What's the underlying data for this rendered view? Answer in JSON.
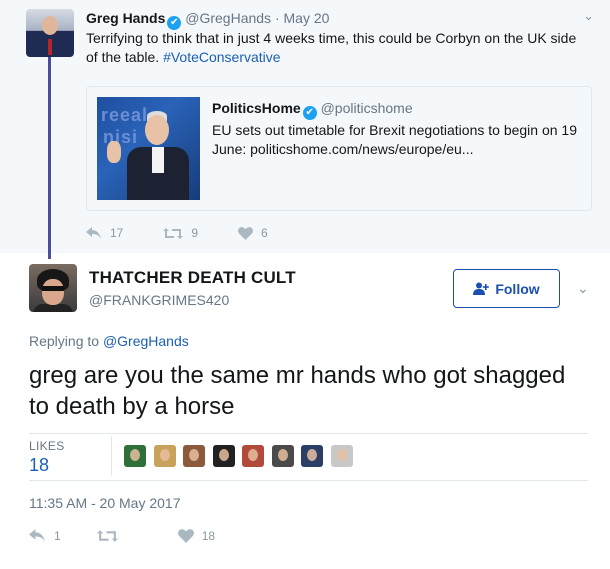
{
  "parent_tweet": {
    "name": "Greg Hands",
    "handle": "@GregHands",
    "date": "· May 20",
    "verified_icon": "✔",
    "caret_icon": "⌄",
    "text": "Terrifying to think that in just 4 weeks time, this could be Corbyn on the UK side of the table. ",
    "hashtag": "#VoteConservative",
    "quoted": {
      "name": "PoliticsHome",
      "handle": "@politicshome",
      "text": "EU sets out timetable for Brexit negotiations to begin on 19 June: politicshome.com/news/europe/eu..."
    },
    "actions": {
      "reply_icon": "reply-icon",
      "replies": "17",
      "retweet_icon": "retweet-icon",
      "retweets": "9",
      "like_icon": "heart-icon",
      "likes": "6"
    }
  },
  "main_tweet": {
    "name": "THATCHER DEATH CULT",
    "handle": "@FRANKGRIMES420",
    "follow_label": "Follow",
    "caret_icon": "⌄",
    "replying_prefix": "Replying to ",
    "replying_to": "@GregHands",
    "text": "greg are you the same mr hands who got shagged to death by a horse",
    "likes_label": "LIKES",
    "likes_count": "18",
    "liker_avatar_colors": [
      "#2f6f3a",
      "#c9a25a",
      "#8a5a3a",
      "#222222",
      "#b04a3a",
      "#4a4a4a",
      "#2b3f66",
      "#c8c8c8"
    ],
    "timestamp": "11:35 AM - 20 May 2017",
    "actions": {
      "replies": "1",
      "retweets": "",
      "likes": "18"
    }
  },
  "colors": {
    "link": "#1b5fb3",
    "thread_line": "#4a4e9c",
    "muted": "#657786",
    "parent_bg": "#f5f8fa"
  }
}
